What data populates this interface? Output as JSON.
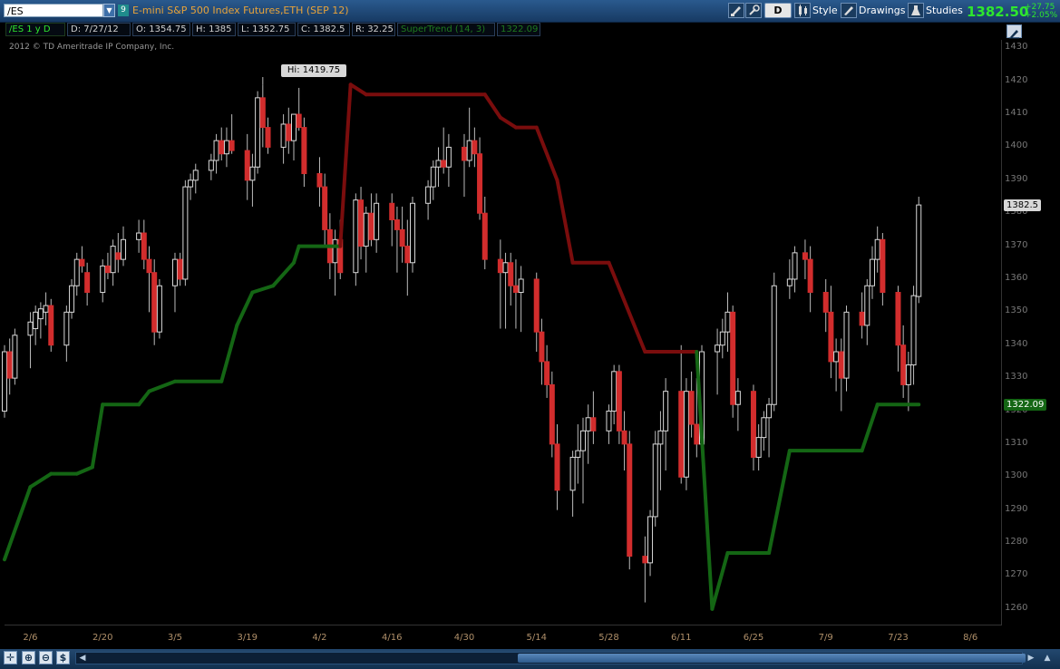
{
  "toolbar": {
    "symbol": "/ES",
    "symbol_num": "9",
    "description": "E-mini S&P 500 Index Futures,ETH (SEP 12)",
    "aggregation": "D",
    "style_label": "Style",
    "drawings_label": "Drawings",
    "studies_label": "Studies",
    "last_price": "1382.50",
    "change": "+27.75",
    "change_pct": "+2.05%"
  },
  "infobar": {
    "symbol": "/ES 1 y D",
    "date": "D: 7/27/12",
    "open": "O: 1354.75",
    "high": "H: 1385",
    "low": "L: 1352.75",
    "close": "C: 1382.5",
    "range": "R: 32.25",
    "study": "SuperTrend (14, 3)",
    "study_value": "1322.09"
  },
  "copyright": "2012 © TD Ameritrade IP Company, Inc.",
  "colors": {
    "up_candle": "#d9d9d9",
    "down_candle": "#d22d2d",
    "supertrend_up": "#146614",
    "supertrend_down": "#7a0d0d",
    "background": "#000000",
    "accent": "#2ee62e"
  },
  "chart_data": {
    "type": "line",
    "title": "",
    "y_axis_ticks": [
      1430,
      1420,
      1410,
      1400,
      1390,
      1380,
      1370,
      1360,
      1350,
      1340,
      1330,
      1320,
      1310,
      1300,
      1290,
      1280,
      1270,
      1260
    ],
    "x_axis_ticks": [
      "2/6",
      "2/20",
      "3/5",
      "3/19",
      "4/2",
      "4/16",
      "4/30",
      "5/14",
      "5/28",
      "6/11",
      "6/25",
      "7/9",
      "7/23",
      "8/6"
    ],
    "ylim": [
      1255,
      1432
    ],
    "high_annotation": "Hi: 1419.75",
    "last_price_tag": "1382.5",
    "study_tag": "1322.09",
    "series": [
      {
        "name": "SuperTrend (14, 3)",
        "kind": "supertrend",
        "points": [
          {
            "x": "2012-02-01",
            "y": 1275,
            "trend": "up"
          },
          {
            "x": "2012-02-06",
            "y": 1297,
            "trend": "up"
          },
          {
            "x": "2012-02-10",
            "y": 1301,
            "trend": "up"
          },
          {
            "x": "2012-02-15",
            "y": 1301,
            "trend": "up"
          },
          {
            "x": "2012-02-18",
            "y": 1303,
            "trend": "up"
          },
          {
            "x": "2012-02-20",
            "y": 1322,
            "trend": "up"
          },
          {
            "x": "2012-02-27",
            "y": 1322,
            "trend": "up"
          },
          {
            "x": "2012-02-29",
            "y": 1326,
            "trend": "up"
          },
          {
            "x": "2012-03-05",
            "y": 1329,
            "trend": "up"
          },
          {
            "x": "2012-03-14",
            "y": 1329,
            "trend": "up"
          },
          {
            "x": "2012-03-17",
            "y": 1346,
            "trend": "up"
          },
          {
            "x": "2012-03-20",
            "y": 1356,
            "trend": "up"
          },
          {
            "x": "2012-03-24",
            "y": 1358,
            "trend": "up"
          },
          {
            "x": "2012-03-28",
            "y": 1365,
            "trend": "up"
          },
          {
            "x": "2012-03-29",
            "y": 1370,
            "trend": "up"
          },
          {
            "x": "2012-04-06",
            "y": 1370,
            "trend": "up"
          },
          {
            "x": "2012-04-08",
            "y": 1419,
            "trend": "down"
          },
          {
            "x": "2012-04-11",
            "y": 1416,
            "trend": "down"
          },
          {
            "x": "2012-05-04",
            "y": 1416,
            "trend": "down"
          },
          {
            "x": "2012-05-07",
            "y": 1409,
            "trend": "down"
          },
          {
            "x": "2012-05-10",
            "y": 1406,
            "trend": "down"
          },
          {
            "x": "2012-05-14",
            "y": 1406,
            "trend": "down"
          },
          {
            "x": "2012-05-18",
            "y": 1390,
            "trend": "down"
          },
          {
            "x": "2012-05-21",
            "y": 1365,
            "trend": "down"
          },
          {
            "x": "2012-05-28",
            "y": 1365,
            "trend": "down"
          },
          {
            "x": "2012-06-04",
            "y": 1338,
            "trend": "down"
          },
          {
            "x": "2012-06-14",
            "y": 1338,
            "trend": "down"
          },
          {
            "x": "2012-06-17",
            "y": 1260,
            "trend": "up"
          },
          {
            "x": "2012-06-20",
            "y": 1277,
            "trend": "up"
          },
          {
            "x": "2012-06-28",
            "y": 1277,
            "trend": "up"
          },
          {
            "x": "2012-07-02",
            "y": 1308,
            "trend": "up"
          },
          {
            "x": "2012-07-16",
            "y": 1308,
            "trend": "up"
          },
          {
            "x": "2012-07-19",
            "y": 1322,
            "trend": "up"
          },
          {
            "x": "2012-07-27",
            "y": 1322,
            "trend": "up"
          }
        ]
      }
    ],
    "ohlc": [
      [
        "2012-02-01",
        1320,
        1340,
        1318,
        1338
      ],
      [
        "2012-02-02",
        1338,
        1342,
        1325,
        1330
      ],
      [
        "2012-02-03",
        1330,
        1345,
        1328,
        1343
      ],
      [
        "2012-02-06",
        1343,
        1350,
        1333,
        1347
      ],
      [
        "2012-02-07",
        1345,
        1352,
        1340,
        1350
      ],
      [
        "2012-02-08",
        1348,
        1353,
        1342,
        1351
      ],
      [
        "2012-02-09",
        1350,
        1356,
        1346,
        1352
      ],
      [
        "2012-02-10",
        1352,
        1354,
        1338,
        1340
      ],
      [
        "2012-02-13",
        1340,
        1352,
        1335,
        1350
      ],
      [
        "2012-02-14",
        1350,
        1360,
        1348,
        1358
      ],
      [
        "2012-02-15",
        1358,
        1368,
        1355,
        1366
      ],
      [
        "2012-02-16",
        1366,
        1370,
        1362,
        1364
      ],
      [
        "2012-02-17",
        1362,
        1365,
        1352,
        1356
      ],
      [
        "2012-02-20",
        1356,
        1366,
        1353,
        1364
      ],
      [
        "2012-02-21",
        1364,
        1368,
        1360,
        1362
      ],
      [
        "2012-02-22",
        1362,
        1372,
        1358,
        1370
      ],
      [
        "2012-02-23",
        1368,
        1374,
        1362,
        1366
      ],
      [
        "2012-02-24",
        1366,
        1376,
        1364,
        1372
      ],
      [
        "2012-02-27",
        1372,
        1378,
        1368,
        1374
      ],
      [
        "2012-02-28",
        1374,
        1378,
        1363,
        1366
      ],
      [
        "2012-02-29",
        1366,
        1370,
        1350,
        1362
      ],
      [
        "2012-03-01",
        1362,
        1366,
        1340,
        1344
      ],
      [
        "2012-03-02",
        1344,
        1360,
        1342,
        1358
      ],
      [
        "2012-03-05",
        1358,
        1368,
        1350,
        1366
      ],
      [
        "2012-03-06",
        1366,
        1368,
        1358,
        1360
      ],
      [
        "2012-03-07",
        1360,
        1390,
        1358,
        1388
      ],
      [
        "2012-03-08",
        1388,
        1392,
        1384,
        1390
      ],
      [
        "2012-03-09",
        1390,
        1395,
        1386,
        1393
      ],
      [
        "2012-03-12",
        1393,
        1398,
        1390,
        1396
      ],
      [
        "2012-03-13",
        1396,
        1404,
        1392,
        1402
      ],
      [
        "2012-03-14",
        1402,
        1406,
        1396,
        1398
      ],
      [
        "2012-03-15",
        1398,
        1406,
        1394,
        1402
      ],
      [
        "2012-03-16",
        1402,
        1410,
        1398,
        1399
      ],
      [
        "2012-03-19",
        1399,
        1404,
        1384,
        1390
      ],
      [
        "2012-03-20",
        1390,
        1398,
        1382,
        1394
      ],
      [
        "2012-03-21",
        1394,
        1417,
        1392,
        1415
      ],
      [
        "2012-03-22",
        1415,
        1419,
        1400,
        1406
      ],
      [
        "2012-03-23",
        1406,
        1409,
        1398,
        1400
      ],
      [
        "2012-03-26",
        1400,
        1410,
        1395,
        1407
      ],
      [
        "2012-03-27",
        1407,
        1412,
        1398,
        1402
      ],
      [
        "2012-03-28",
        1402,
        1408,
        1396,
        1410
      ],
      [
        "2012-03-29",
        1410,
        1418,
        1405,
        1406
      ],
      [
        "2012-03-30",
        1406,
        1409,
        1388,
        1392
      ],
      [
        "2012-04-02",
        1392,
        1397,
        1382,
        1388
      ],
      [
        "2012-04-03",
        1388,
        1392,
        1370,
        1375
      ],
      [
        "2012-04-04",
        1375,
        1380,
        1360,
        1365
      ],
      [
        "2012-04-05",
        1365,
        1375,
        1355,
        1372
      ],
      [
        "2012-04-06",
        1372,
        1378,
        1360,
        1362
      ],
      [
        "2012-04-09",
        1362,
        1386,
        1358,
        1384
      ],
      [
        "2012-04-10",
        1384,
        1388,
        1366,
        1370
      ],
      [
        "2012-04-11",
        1370,
        1382,
        1362,
        1380
      ],
      [
        "2012-04-12",
        1380,
        1386,
        1370,
        1372
      ],
      [
        "2012-04-13",
        1372,
        1386,
        1368,
        1383
      ],
      [
        "2012-04-16",
        1383,
        1386,
        1370,
        1378
      ],
      [
        "2012-04-17",
        1378,
        1382,
        1362,
        1375
      ],
      [
        "2012-04-18",
        1375,
        1382,
        1365,
        1370
      ],
      [
        "2012-04-19",
        1370,
        1378,
        1355,
        1365
      ],
      [
        "2012-04-20",
        1365,
        1385,
        1362,
        1383
      ],
      [
        "2012-04-23",
        1383,
        1390,
        1378,
        1388
      ],
      [
        "2012-04-24",
        1388,
        1396,
        1384,
        1394
      ],
      [
        "2012-04-25",
        1394,
        1400,
        1388,
        1396
      ],
      [
        "2012-04-26",
        1396,
        1406,
        1392,
        1394
      ],
      [
        "2012-04-27",
        1394,
        1404,
        1388,
        1400
      ],
      [
        "2012-04-30",
        1400,
        1404,
        1385,
        1396
      ],
      [
        "2012-05-01",
        1396,
        1412,
        1394,
        1402
      ],
      [
        "2012-05-02",
        1402,
        1406,
        1394,
        1398
      ],
      [
        "2012-05-03",
        1398,
        1403,
        1378,
        1380
      ],
      [
        "2012-05-04",
        1380,
        1385,
        1363,
        1366
      ],
      [
        "2012-05-07",
        1366,
        1372,
        1345,
        1362
      ],
      [
        "2012-05-08",
        1362,
        1368,
        1345,
        1365
      ],
      [
        "2012-05-09",
        1365,
        1368,
        1352,
        1358
      ],
      [
        "2012-05-10",
        1358,
        1366,
        1345,
        1356
      ],
      [
        "2012-05-11",
        1356,
        1364,
        1344,
        1360
      ],
      [
        "2012-05-14",
        1360,
        1362,
        1338,
        1344
      ],
      [
        "2012-05-15",
        1344,
        1348,
        1328,
        1335
      ],
      [
        "2012-05-16",
        1335,
        1340,
        1324,
        1328
      ],
      [
        "2012-05-17",
        1328,
        1332,
        1306,
        1310
      ],
      [
        "2012-05-18",
        1310,
        1316,
        1290,
        1296
      ],
      [
        "2012-05-21",
        1296,
        1308,
        1288,
        1306
      ],
      [
        "2012-05-22",
        1306,
        1316,
        1298,
        1308
      ],
      [
        "2012-05-23",
        1308,
        1318,
        1292,
        1314
      ],
      [
        "2012-05-24",
        1314,
        1322,
        1304,
        1318
      ],
      [
        "2012-05-25",
        1318,
        1326,
        1310,
        1314
      ],
      [
        "2012-05-28",
        1314,
        1322,
        1310,
        1320
      ],
      [
        "2012-05-29",
        1320,
        1334,
        1316,
        1332
      ],
      [
        "2012-05-30",
        1332,
        1334,
        1310,
        1314
      ],
      [
        "2012-05-31",
        1314,
        1320,
        1302,
        1310
      ],
      [
        "2012-06-01",
        1310,
        1314,
        1272,
        1276
      ],
      [
        "2012-06-04",
        1276,
        1282,
        1262,
        1274
      ],
      [
        "2012-06-05",
        1274,
        1290,
        1270,
        1288
      ],
      [
        "2012-06-06",
        1288,
        1314,
        1285,
        1310
      ],
      [
        "2012-06-07",
        1310,
        1320,
        1296,
        1314
      ],
      [
        "2012-06-08",
        1314,
        1330,
        1302,
        1326
      ],
      [
        "2012-06-11",
        1326,
        1340,
        1298,
        1300
      ],
      [
        "2012-06-12",
        1300,
        1330,
        1296,
        1326
      ],
      [
        "2012-06-13",
        1326,
        1332,
        1312,
        1316
      ],
      [
        "2012-06-14",
        1316,
        1330,
        1306,
        1310
      ],
      [
        "2012-06-15",
        1310,
        1340,
        1305,
        1338
      ],
      [
        "2012-06-18",
        1338,
        1345,
        1325,
        1340
      ],
      [
        "2012-06-19",
        1340,
        1348,
        1336,
        1344
      ],
      [
        "2012-06-20",
        1344,
        1356,
        1338,
        1350
      ],
      [
        "2012-06-21",
        1350,
        1352,
        1318,
        1322
      ],
      [
        "2012-06-22",
        1322,
        1330,
        1314,
        1326
      ],
      [
        "2012-06-25",
        1326,
        1328,
        1302,
        1306
      ],
      [
        "2012-06-26",
        1306,
        1316,
        1302,
        1312
      ],
      [
        "2012-06-27",
        1312,
        1320,
        1308,
        1318
      ],
      [
        "2012-06-28",
        1318,
        1324,
        1306,
        1322
      ],
      [
        "2012-06-29",
        1322,
        1362,
        1320,
        1358
      ],
      [
        "2012-07-02",
        1358,
        1366,
        1354,
        1360
      ],
      [
        "2012-07-03",
        1360,
        1370,
        1356,
        1368
      ],
      [
        "2012-07-05",
        1368,
        1372,
        1360,
        1366
      ],
      [
        "2012-07-06",
        1366,
        1370,
        1350,
        1356
      ],
      [
        "2012-07-09",
        1356,
        1360,
        1344,
        1350
      ],
      [
        "2012-07-10",
        1350,
        1358,
        1330,
        1335
      ],
      [
        "2012-07-11",
        1335,
        1342,
        1326,
        1338
      ],
      [
        "2012-07-12",
        1338,
        1342,
        1320,
        1330
      ],
      [
        "2012-07-13",
        1330,
        1352,
        1326,
        1350
      ],
      [
        "2012-07-16",
        1350,
        1356,
        1342,
        1346
      ],
      [
        "2012-07-17",
        1346,
        1360,
        1340,
        1358
      ],
      [
        "2012-07-18",
        1358,
        1370,
        1354,
        1366
      ],
      [
        "2012-07-19",
        1366,
        1376,
        1362,
        1372
      ],
      [
        "2012-07-20",
        1372,
        1374,
        1352,
        1356
      ],
      [
        "2012-07-23",
        1356,
        1358,
        1332,
        1340
      ],
      [
        "2012-07-24",
        1340,
        1346,
        1324,
        1328
      ],
      [
        "2012-07-25",
        1328,
        1338,
        1320,
        1334
      ],
      [
        "2012-07-26",
        1334,
        1358,
        1328,
        1355
      ],
      [
        "2012-07-27",
        1354.75,
        1385,
        1352.75,
        1382.5
      ]
    ]
  }
}
